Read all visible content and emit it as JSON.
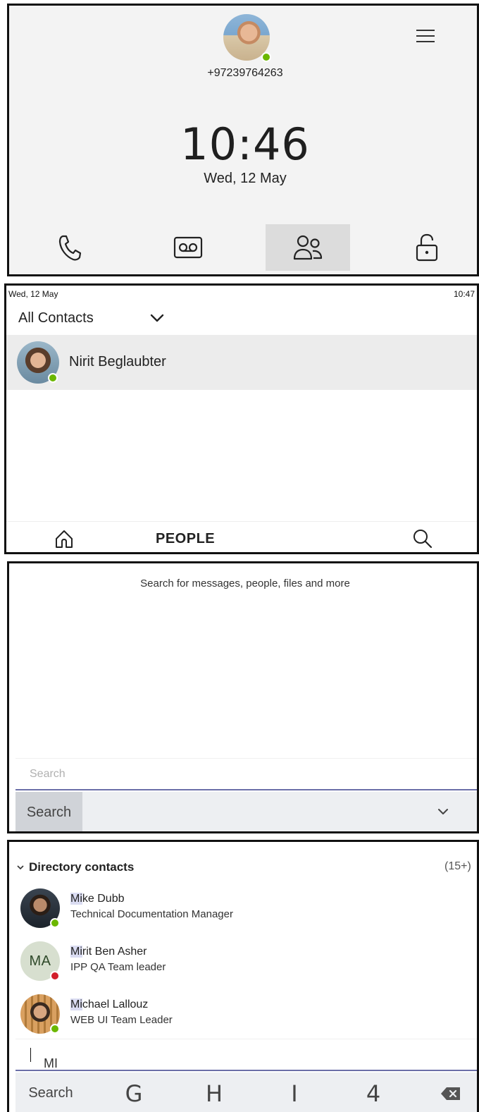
{
  "home": {
    "phone_number": "+97239764263",
    "time": "10:46",
    "date": "Wed, 12 May",
    "nav": [
      {
        "icon": "phone-icon"
      },
      {
        "icon": "voicemail-icon"
      },
      {
        "icon": "people-icon",
        "active": true
      },
      {
        "icon": "lock-icon"
      }
    ]
  },
  "people": {
    "status_date": "Wed, 12 May",
    "status_time": "10:47",
    "filter_label": "All Contacts",
    "contacts": [
      {
        "name": "Nirit Beglaubter",
        "presence": "available"
      }
    ],
    "tab_title": "PEOPLE"
  },
  "search": {
    "hint": "Search for messages, people, files and more",
    "placeholder": "Search",
    "keyboard_label": "Search"
  },
  "directory": {
    "section_title": "Directory contacts",
    "count": "(15+)",
    "results": [
      {
        "match": "Mi",
        "rest": "ke Dubb",
        "title": "Technical Documentation Manager",
        "presence": "available"
      },
      {
        "match": "Mi",
        "rest": "rit Ben Asher",
        "title": "IPP QA Team leader",
        "presence": "busy",
        "initials": "MA"
      },
      {
        "match": "Mi",
        "rest": "chael Lallouz",
        "title": "WEB UI Team Leader",
        "presence": "available"
      }
    ],
    "typed_text": "MI",
    "keyboard_label": "Search",
    "keys": [
      "G",
      "H",
      "I",
      "4"
    ]
  },
  "colors": {
    "presence_available": "#6bb700",
    "presence_busy": "#d21f2b",
    "input_underline": "#6b6fa8",
    "match_highlight": "#dadcf2"
  }
}
